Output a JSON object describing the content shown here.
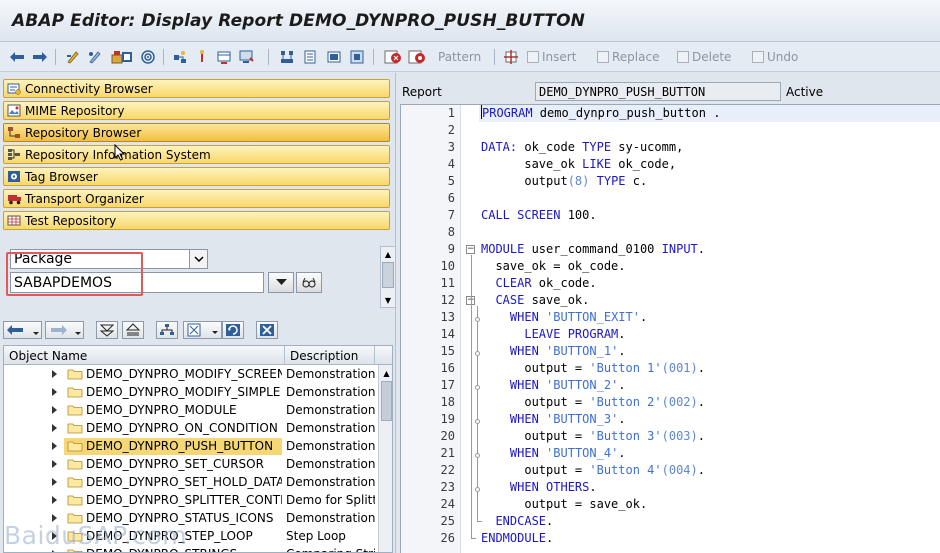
{
  "window": {
    "title": "ABAP Editor: Display Report DEMO_DYNPRO_PUSH_BUTTON"
  },
  "toolbar": {
    "buttons": [
      "back-icon",
      "forward-icon",
      "other-object-icon",
      "display-change-icon",
      "active-inactive-icon",
      "object-list-icon",
      "where-used-icon",
      "navigation-window-icon",
      "enhance-icon",
      "check-icon",
      "activate-icon",
      "test-icon",
      "display-object-list-icon",
      "breakpoint-icon",
      "help-icon"
    ],
    "pattern_label": "Pattern",
    "insert_label": "Insert",
    "replace_label": "Replace",
    "delete_label": "Delete",
    "undo_label": "Undo",
    "pretty_printer_icon": "pretty-printer-icon"
  },
  "navigator": {
    "items": [
      {
        "label": "Connectivity Browser",
        "icon": "connectivity-icon"
      },
      {
        "label": "MIME Repository",
        "icon": "mime-icon"
      },
      {
        "label": "Repository Browser",
        "icon": "repository-browser-icon",
        "active": true
      },
      {
        "label": "Repository Information System",
        "icon": "info-system-icon"
      },
      {
        "label": "Tag Browser",
        "icon": "tag-icon"
      },
      {
        "label": "Transport Organizer",
        "icon": "transport-icon"
      },
      {
        "label": "Test Repository",
        "icon": "test-repository-icon"
      }
    ]
  },
  "object_selection": {
    "type_value": "Package",
    "name_value": "SABAPDEMOS"
  },
  "tree": {
    "columns": [
      "Object Name",
      "Description"
    ],
    "rows": [
      {
        "name": "DEMO_DYNPRO_MODIFY_SCREEN",
        "desc": "Demonstration c"
      },
      {
        "name": "DEMO_DYNPRO_MODIFY_SIMPLE",
        "desc": "Demonstration f"
      },
      {
        "name": "DEMO_DYNPRO_MODULE",
        "desc": "Demonstration c"
      },
      {
        "name": "DEMO_DYNPRO_ON_CONDITION",
        "desc": "Demonstration f"
      },
      {
        "name": "DEMO_DYNPRO_PUSH_BUTTON",
        "desc": "Demonstration f",
        "selected": true
      },
      {
        "name": "DEMO_DYNPRO_SET_CURSOR",
        "desc": "Demonstration f"
      },
      {
        "name": "DEMO_DYNPRO_SET_HOLD_DATA",
        "desc": "Demonstration f"
      },
      {
        "name": "DEMO_DYNPRO_SPLITTER_CONTRO",
        "desc": "Demo for Splitte"
      },
      {
        "name": "DEMO_DYNPRO_STATUS_ICONS",
        "desc": "Demonstration f"
      },
      {
        "name": "DEMO_DYNPRO_STEP_LOOP",
        "desc": "Step Loop"
      },
      {
        "name": "DEMO_DYNPRO_STRINGS",
        "desc": "Comparing Strin"
      }
    ]
  },
  "editor": {
    "report_label": "Report",
    "report_name": "DEMO_DYNPRO_PUSH_BUTTON",
    "status": "Active",
    "lines": [
      "1",
      "2",
      "3",
      "4",
      "5",
      "6",
      "7",
      "8",
      "9",
      "10",
      "11",
      "12",
      "13",
      "14",
      "15",
      "16",
      "17",
      "18",
      "19",
      "20",
      "21",
      "22",
      "23",
      "24",
      "25",
      "26"
    ]
  },
  "watermark": "BaiduSAP.com"
}
